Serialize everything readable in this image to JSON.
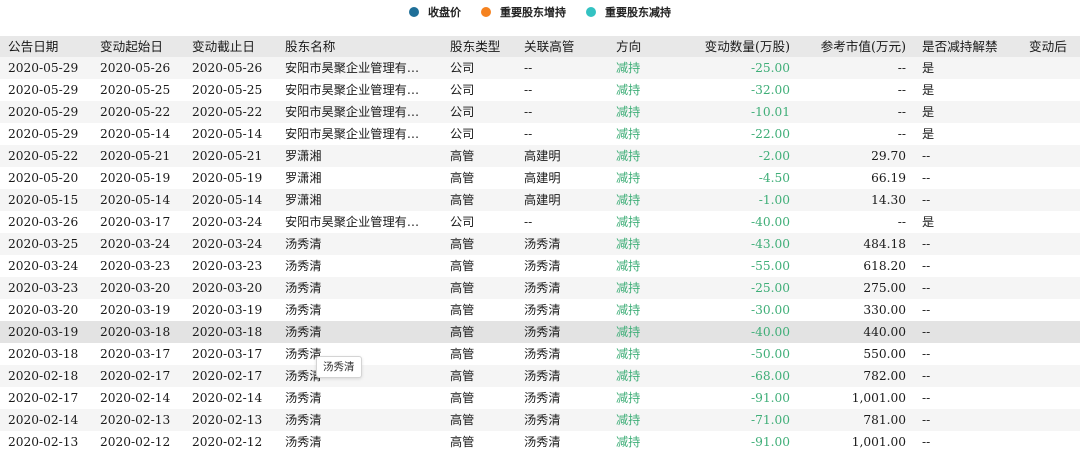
{
  "legend": [
    {
      "label": "收盘价",
      "color": "#1f6f98"
    },
    {
      "label": "重要股东增持",
      "color": "#f5821f"
    },
    {
      "label": "重要股东减持",
      "color": "#33c2c2"
    }
  ],
  "table": {
    "headers": [
      "公告日期",
      "变动起始日",
      "变动截止日",
      "股东名称",
      "股东类型",
      "关联高管",
      "方向",
      "变动数量(万股)",
      "参考市值(万元)",
      "是否减持解禁",
      "变动后"
    ],
    "rows": [
      [
        "2020-05-29",
        "2020-05-26",
        "2020-05-26",
        "安阳市昊聚企业管理有…",
        "公司",
        "--",
        "减持",
        "-25.00",
        "--",
        "是"
      ],
      [
        "2020-05-29",
        "2020-05-25",
        "2020-05-25",
        "安阳市昊聚企业管理有…",
        "公司",
        "--",
        "减持",
        "-32.00",
        "--",
        "是"
      ],
      [
        "2020-05-29",
        "2020-05-22",
        "2020-05-22",
        "安阳市昊聚企业管理有…",
        "公司",
        "--",
        "减持",
        "-10.01",
        "--",
        "是"
      ],
      [
        "2020-05-29",
        "2020-05-14",
        "2020-05-14",
        "安阳市昊聚企业管理有…",
        "公司",
        "--",
        "减持",
        "-22.00",
        "--",
        "是"
      ],
      [
        "2020-05-22",
        "2020-05-21",
        "2020-05-21",
        "罗潇湘",
        "高管",
        "高建明",
        "减持",
        "-2.00",
        "29.70",
        "--"
      ],
      [
        "2020-05-20",
        "2020-05-19",
        "2020-05-19",
        "罗潇湘",
        "高管",
        "高建明",
        "减持",
        "-4.50",
        "66.19",
        "--"
      ],
      [
        "2020-05-15",
        "2020-05-14",
        "2020-05-14",
        "罗潇湘",
        "高管",
        "高建明",
        "减持",
        "-1.00",
        "14.30",
        "--"
      ],
      [
        "2020-03-26",
        "2020-03-17",
        "2020-03-24",
        "安阳市昊聚企业管理有…",
        "公司",
        "--",
        "减持",
        "-40.00",
        "--",
        "是"
      ],
      [
        "2020-03-25",
        "2020-03-24",
        "2020-03-24",
        "汤秀清",
        "高管",
        "汤秀清",
        "减持",
        "-43.00",
        "484.18",
        "--"
      ],
      [
        "2020-03-24",
        "2020-03-23",
        "2020-03-23",
        "汤秀清",
        "高管",
        "汤秀清",
        "减持",
        "-55.00",
        "618.20",
        "--"
      ],
      [
        "2020-03-23",
        "2020-03-20",
        "2020-03-20",
        "汤秀清",
        "高管",
        "汤秀清",
        "减持",
        "-25.00",
        "275.00",
        "--"
      ],
      [
        "2020-03-20",
        "2020-03-19",
        "2020-03-19",
        "汤秀清",
        "高管",
        "汤秀清",
        "减持",
        "-30.00",
        "330.00",
        "--"
      ],
      [
        "2020-03-19",
        "2020-03-18",
        "2020-03-18",
        "汤秀清",
        "高管",
        "汤秀清",
        "减持",
        "-40.00",
        "440.00",
        "--"
      ],
      [
        "2020-03-18",
        "2020-03-17",
        "2020-03-17",
        "汤秀清",
        "高管",
        "汤秀清",
        "减持",
        "-50.00",
        "550.00",
        "--"
      ],
      [
        "2020-02-18",
        "2020-02-17",
        "2020-02-17",
        "汤秀清",
        "高管",
        "汤秀清",
        "减持",
        "-68.00",
        "782.00",
        "--"
      ],
      [
        "2020-02-17",
        "2020-02-14",
        "2020-02-14",
        "汤秀清",
        "高管",
        "汤秀清",
        "减持",
        "-91.00",
        "1,001.00",
        "--"
      ],
      [
        "2020-02-14",
        "2020-02-13",
        "2020-02-13",
        "汤秀清",
        "高管",
        "汤秀清",
        "减持",
        "-71.00",
        "781.00",
        "--"
      ],
      [
        "2020-02-13",
        "2020-02-12",
        "2020-02-12",
        "汤秀清",
        "高管",
        "汤秀清",
        "减持",
        "-91.00",
        "1,001.00",
        "--"
      ]
    ],
    "highlighted_row": 12
  },
  "tooltip": {
    "text": "汤秀清"
  }
}
